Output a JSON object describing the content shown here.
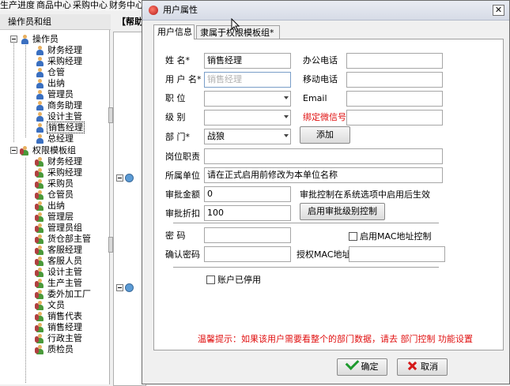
{
  "app": {
    "menu": [
      "生产进度",
      "商品中心",
      "采购中心",
      "财务中心"
    ],
    "left_panel_title": "操作员和组",
    "mid_panel_title": "【帮助",
    "tree": {
      "operators_root": "操作员",
      "operators": [
        "财务经理",
        "采购经理",
        "仓管",
        "出纳",
        "管理员",
        "商务助理",
        "设计主管",
        "销售经理",
        "总经理"
      ],
      "selected_operator": "销售经理",
      "groups_root": "权限模板组",
      "groups": [
        "财务经理",
        "采购经理",
        "采购员",
        "仓管员",
        "出纳",
        "管理层",
        "管理员组",
        "货仓部主管",
        "客服经理",
        "客服人员",
        "设计主管",
        "生产主管",
        "委外加工厂",
        "文员",
        "销售代表",
        "销售经理",
        "行政主管",
        "质检员"
      ]
    }
  },
  "dialog": {
    "title": "用户属性",
    "close_glyph": "✕",
    "tabs": [
      "用户信息",
      "隶属于权限模板组*"
    ],
    "form": {
      "name_label": "姓    名*",
      "name_value": "销售经理",
      "username_label": "用 户 名*",
      "username_value": "销售经理",
      "position_label": "职    位",
      "position_value": "",
      "level_label": "级    别",
      "level_value": "",
      "dept_label": "部    门*",
      "dept_value": "战狼",
      "office_phone_label": "办公电话",
      "office_phone_value": "",
      "mobile_label": "移动电话",
      "mobile_value": "",
      "email_label": "Email",
      "email_value": "",
      "wechat_label": "绑定微信号",
      "wechat_value": "",
      "add_button": "添加",
      "duty_label": "岗位职责",
      "duty_value": "",
      "unit_label": "所属单位",
      "unit_value": "请在正式启用前修改为本单位名称",
      "amount_label": "审批金额",
      "amount_value": "0",
      "amount_note": "审批控制在系统选项中启用后生效",
      "discount_label": "审批折扣",
      "discount_value": "100",
      "level_control_button": "启用审批级别控制",
      "password_label": "密    码",
      "password_value": "",
      "mac_check_label": "启用MAC地址控制",
      "confirm_pwd_label": "确认密码",
      "confirm_pwd_value": "",
      "mac_label": "授权MAC地址",
      "mac_value": "",
      "disabled_label": "账户已停用",
      "hint": "温馨提示：如果该用户需要看整个的部门数据，请去 部门控制 功能设置"
    },
    "ok_button": "确定",
    "cancel_button": "取消"
  },
  "colors": {
    "hint": "#e01010",
    "wechat_label": "#e01010",
    "ok_icon": "#1e9a2e",
    "cancel_icon": "#d51a1a"
  }
}
